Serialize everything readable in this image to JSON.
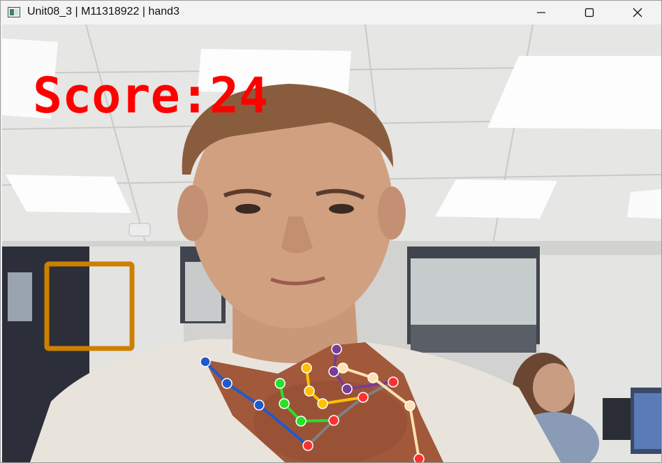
{
  "window": {
    "title": "Unit08_3 | M11318922 | hand3",
    "app_icon": "opencv-window-icon",
    "controls": {
      "minimize": "minimize-icon",
      "maximize": "maximize-icon",
      "close": "close-icon"
    }
  },
  "video": {
    "score_text": "Score:24",
    "score_color": "#ff0000",
    "target_box_color": "#cc8000",
    "hand_colors": {
      "palm": "#808080",
      "thumb": "#1e5ad0",
      "index": "#26e02a",
      "middle": "#ffc000",
      "ring": "#7a3c96",
      "pinky": "#ffe0b0",
      "joint": "#ff3030"
    }
  }
}
